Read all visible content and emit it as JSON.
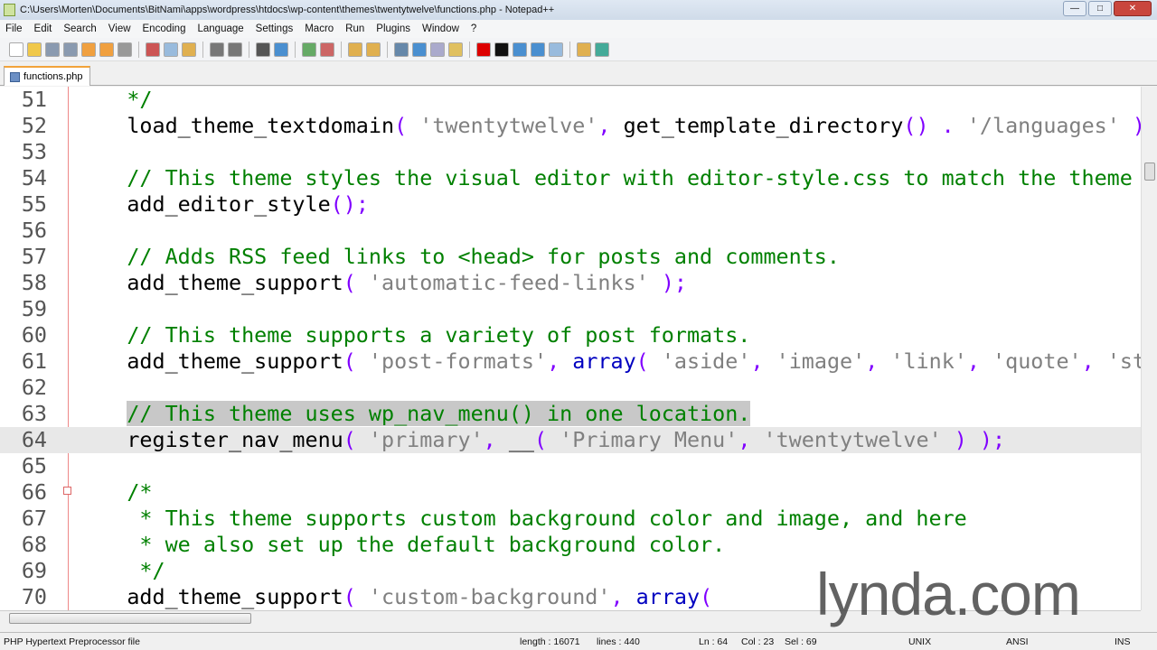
{
  "window": {
    "title": "C:\\Users\\Morten\\Documents\\BitNami\\apps\\wordpress\\htdocs\\wp-content\\themes\\twentytwelve\\functions.php - Notepad++",
    "buttons": {
      "minimize": "—",
      "maximize": "□",
      "close": "✕"
    }
  },
  "menu": [
    "File",
    "Edit",
    "Search",
    "View",
    "Encoding",
    "Language",
    "Settings",
    "Macro",
    "Run",
    "Plugins",
    "Window",
    "?"
  ],
  "tab": {
    "label": "functions.php"
  },
  "colors": {
    "comment": "#008000",
    "string": "#808080",
    "operator": "#8000ff",
    "keyword": "#0000c0",
    "current_line": "#e8e8e8"
  },
  "editor": {
    "current_line": 64,
    "lines": [
      {
        "n": "51",
        "segs": [
          [
            "    */",
            "c"
          ]
        ]
      },
      {
        "n": "52",
        "segs": [
          [
            "    load_theme_textdomain",
            "d"
          ],
          [
            "(",
            "p"
          ],
          [
            " 'twentytwelve'",
            "s"
          ],
          [
            ",",
            "p"
          ],
          [
            " get_template_directory",
            "d"
          ],
          [
            "() .",
            "p"
          ],
          [
            " '/languages'",
            "s"
          ],
          [
            " )",
            "p"
          ]
        ]
      },
      {
        "n": "53",
        "segs": []
      },
      {
        "n": "54",
        "segs": [
          [
            "    // This theme styles the visual editor with editor-style.css to match the theme",
            "c"
          ]
        ]
      },
      {
        "n": "55",
        "segs": [
          [
            "    add_editor_style",
            "d"
          ],
          [
            "();",
            "p"
          ]
        ]
      },
      {
        "n": "56",
        "segs": []
      },
      {
        "n": "57",
        "segs": [
          [
            "    // Adds RSS feed links to <head> for posts and comments.",
            "c"
          ]
        ]
      },
      {
        "n": "58",
        "segs": [
          [
            "    add_theme_support",
            "d"
          ],
          [
            "(",
            "p"
          ],
          [
            " 'automatic-feed-links'",
            "s"
          ],
          [
            " );",
            "p"
          ]
        ]
      },
      {
        "n": "59",
        "segs": []
      },
      {
        "n": "60",
        "segs": [
          [
            "    // This theme supports a variety of post formats.",
            "c"
          ]
        ]
      },
      {
        "n": "61",
        "segs": [
          [
            "    add_theme_support",
            "d"
          ],
          [
            "(",
            "p"
          ],
          [
            " 'post-formats'",
            "s"
          ],
          [
            ",",
            "p"
          ],
          [
            " array",
            "k"
          ],
          [
            "(",
            "p"
          ],
          [
            " 'aside'",
            "s"
          ],
          [
            ",",
            "p"
          ],
          [
            " 'image'",
            "s"
          ],
          [
            ",",
            "p"
          ],
          [
            " 'link'",
            "s"
          ],
          [
            ",",
            "p"
          ],
          [
            " 'quote'",
            "s"
          ],
          [
            ",",
            "p"
          ],
          [
            " 'st",
            "s"
          ]
        ]
      },
      {
        "n": "62",
        "segs": []
      },
      {
        "n": "63",
        "segs": [
          [
            "    ",
            "d"
          ],
          [
            "// This theme uses wp_nav_menu() in one location.",
            "c sel"
          ]
        ]
      },
      {
        "n": "64",
        "segs": [
          [
            "    register_nav_menu",
            "d"
          ],
          [
            "(",
            "p"
          ],
          [
            " 'primary'",
            "s"
          ],
          [
            ",",
            "p"
          ],
          [
            " __",
            "d"
          ],
          [
            "(",
            "p"
          ],
          [
            " 'Primary Menu'",
            "s"
          ],
          [
            ",",
            "p"
          ],
          [
            " 'twentytwelve'",
            "s"
          ],
          [
            " ) );",
            "p"
          ]
        ]
      },
      {
        "n": "65",
        "segs": []
      },
      {
        "n": "66",
        "segs": [
          [
            "    /*",
            "c"
          ]
        ]
      },
      {
        "n": "67",
        "segs": [
          [
            "     * This theme supports custom background color and image, and here",
            "c"
          ]
        ]
      },
      {
        "n": "68",
        "segs": [
          [
            "     * we also set up the default background color.",
            "c"
          ]
        ]
      },
      {
        "n": "69",
        "segs": [
          [
            "     */",
            "c"
          ]
        ]
      },
      {
        "n": "70",
        "segs": [
          [
            "    add_theme_support",
            "d"
          ],
          [
            "(",
            "p"
          ],
          [
            " 'custom-background'",
            "s"
          ],
          [
            ",",
            "p"
          ],
          [
            " array",
            "k"
          ],
          [
            "(",
            "p"
          ]
        ]
      }
    ]
  },
  "status": {
    "filetype": "PHP Hypertext Preprocessor file",
    "length": "length : 16071",
    "lines": "lines : 440",
    "ln": "Ln : 64",
    "col": "Col : 23",
    "sel": "Sel : 69",
    "eol": "UNIX",
    "encoding": "ANSI",
    "mode": "INS"
  },
  "watermark": "lynda.com"
}
